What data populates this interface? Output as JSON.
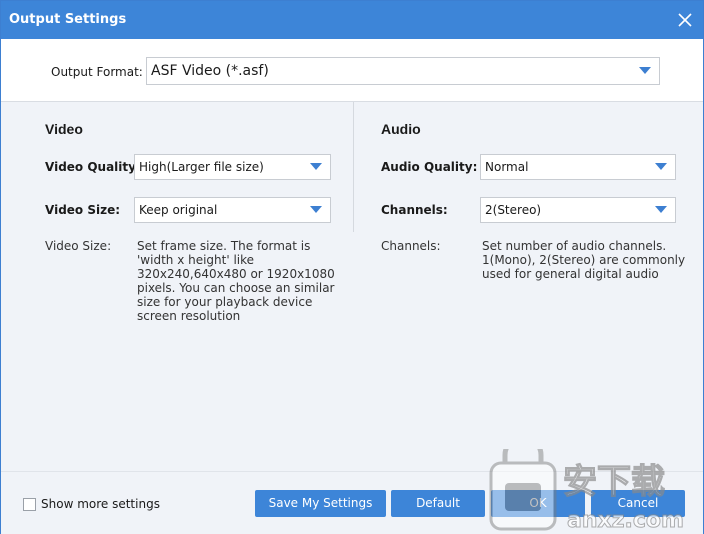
{
  "window": {
    "title": "Output Settings"
  },
  "output_format": {
    "label": "Output Format:",
    "value": "ASF Video (*.asf)"
  },
  "video": {
    "section_title": "Video",
    "quality_label": "Video Quality:",
    "quality_value": "High(Larger file size)",
    "size_label": "Video Size:",
    "size_value": "Keep original",
    "desc_label": "Video Size:",
    "desc_text": "Set frame size. The format is\n'width x height' like\n320x240,640x480 or 1920x1080\npixels. You can choose an similar\nsize for your playback device\nscreen resolution"
  },
  "audio": {
    "section_title": "Audio",
    "quality_label": "Audio Quality:",
    "quality_value": "Normal",
    "channels_label": "Channels:",
    "channels_value": "2(Stereo)",
    "desc_label": "Channels:",
    "desc_text": "Set number of audio channels.\n1(Mono), 2(Stereo) are commonly\nused for general digital audio"
  },
  "footer": {
    "show_more_label": "Show more settings",
    "show_more_checked": false,
    "save_label": "Save My Settings",
    "default_label": "Default",
    "ok_label": "OK",
    "cancel_label": "Cancel"
  },
  "watermark": {
    "text": "安下载",
    "domain": "anxz.com"
  },
  "colors": {
    "accent": "#3d85d8",
    "panel_bg": "#f0f3f8",
    "arrow": "#3d7fd1"
  },
  "icons": {
    "close": "close-icon",
    "dropdown": "chevron-down-icon"
  }
}
